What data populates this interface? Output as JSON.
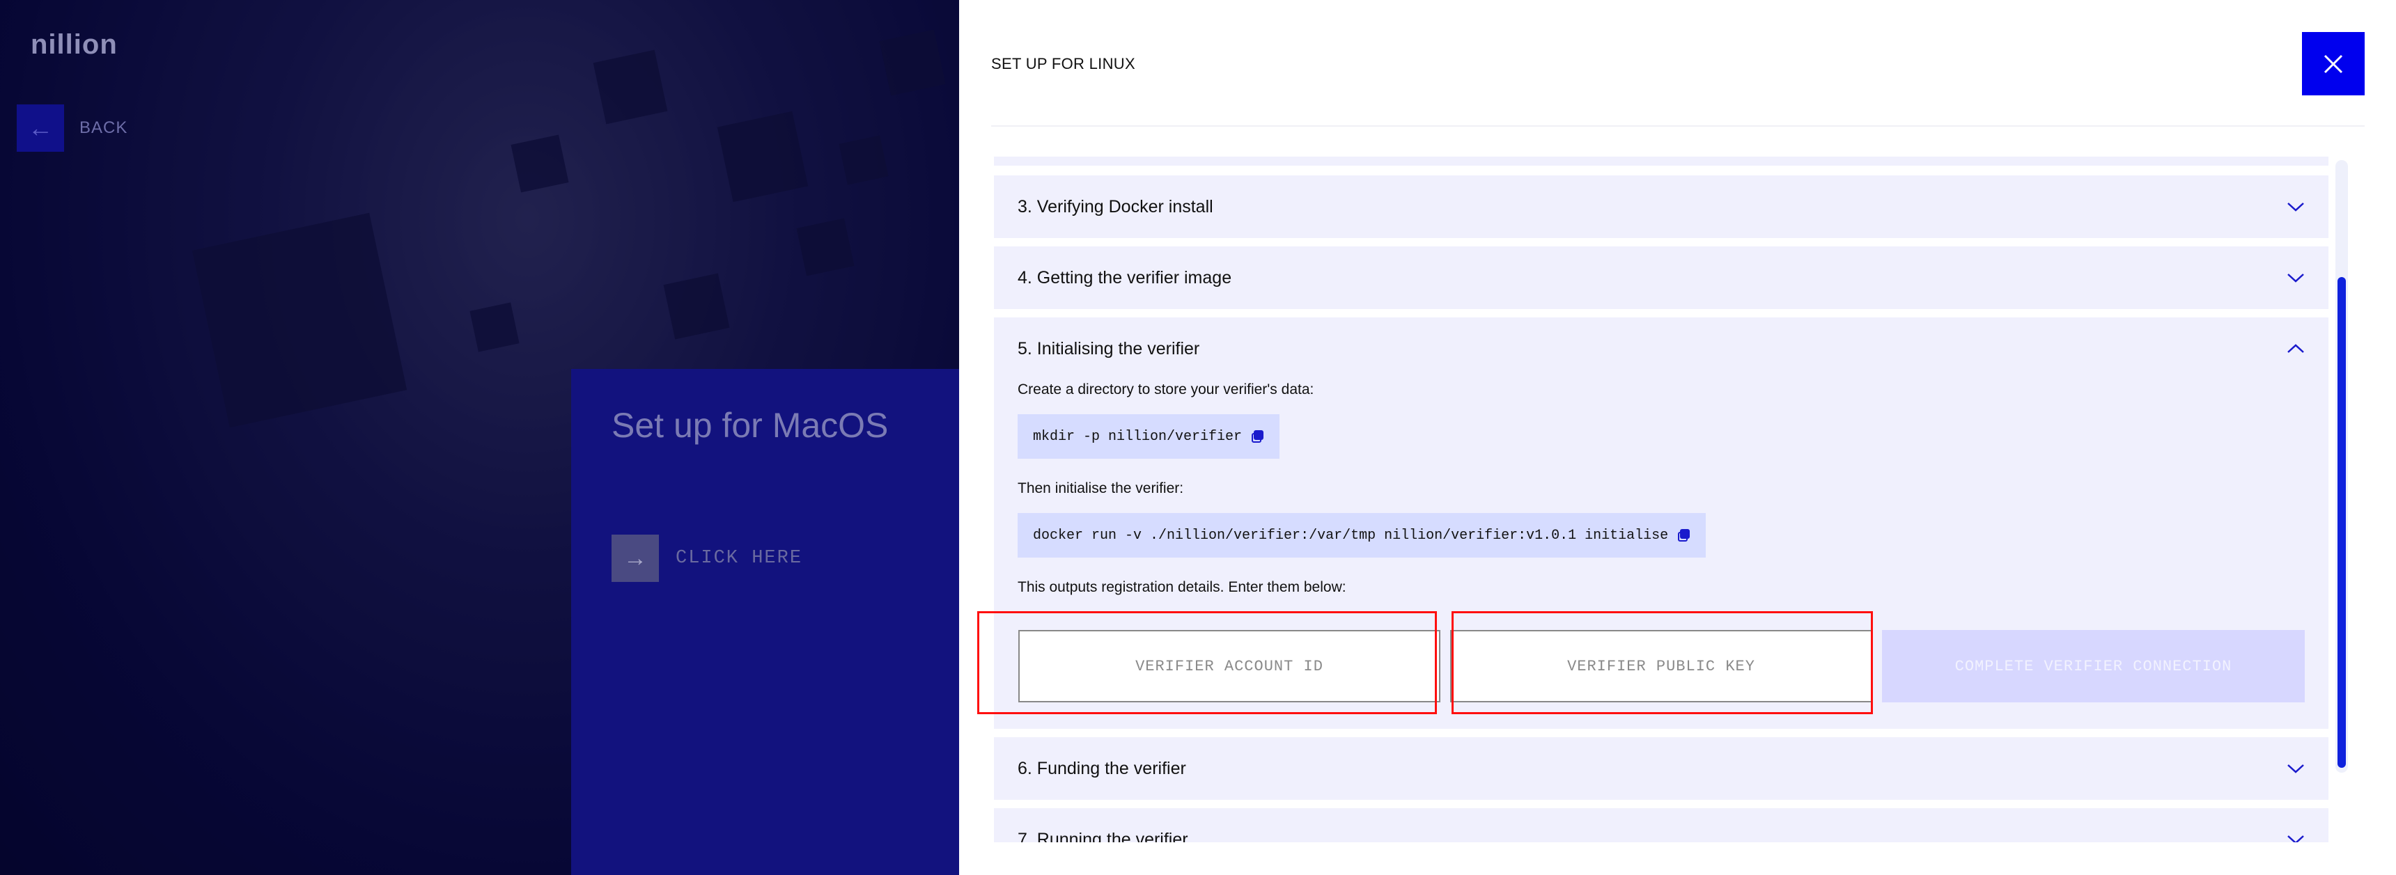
{
  "background": {
    "logo": "nillion",
    "back_label": "BACK",
    "macos_card": {
      "title": "Set up for MacOS",
      "cta": "CLICK HERE"
    }
  },
  "panel": {
    "title": "SET UP FOR LINUX",
    "accent_color": "#0000ee",
    "steps": [
      {
        "title": "3. Verifying Docker install",
        "expanded": false
      },
      {
        "title": "4. Getting the verifier image",
        "expanded": false
      },
      {
        "title": "5. Initialising the verifier",
        "expanded": true
      },
      {
        "title": "6. Funding the verifier",
        "expanded": false
      },
      {
        "title": "7. Running the verifier",
        "expanded": false
      }
    ],
    "step5": {
      "intro": "Create a directory to store your verifier's data:",
      "cmd1": "mkdir -p nillion/verifier",
      "then": "Then initialise the verifier:",
      "cmd2": "docker run -v ./nillion/verifier:/var/tmp nillion/verifier:v1.0.1 initialise",
      "outputs": "This outputs registration details. Enter them below:",
      "account_placeholder": "VERIFIER ACCOUNT ID",
      "pubkey_placeholder": "VERIFIER PUBLIC KEY",
      "complete_label": "COMPLETE VERIFIER CONNECTION"
    }
  }
}
